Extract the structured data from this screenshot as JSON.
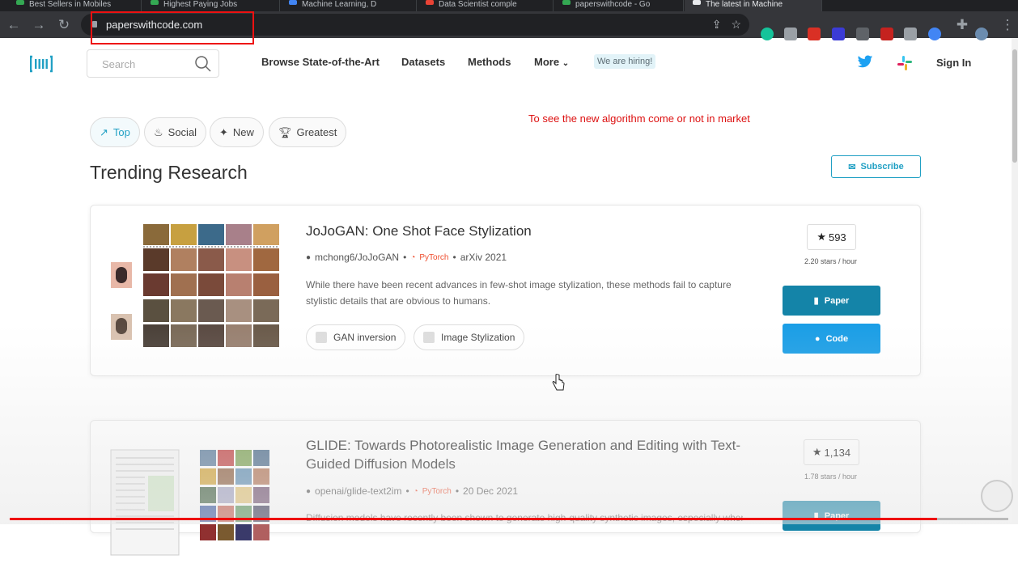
{
  "browser": {
    "tabs": [
      {
        "label": "Best Sellers in Mobiles",
        "color": "#34a853"
      },
      {
        "label": "Highest Paying Jobs",
        "color": "#34a853"
      },
      {
        "label": "Machine Learning, D",
        "color": "#4285f4"
      },
      {
        "label": "Data Scientist comple",
        "color": "#ea4335"
      },
      {
        "label": "paperswithcode - Go",
        "color": "#34a853"
      },
      {
        "label": "The latest in Machine",
        "color": "#e8eaed"
      }
    ],
    "url": "paperswithcode.com"
  },
  "header": {
    "search_placeholder": "Search",
    "nav": [
      "Browse State-of-the-Art",
      "Datasets",
      "Methods",
      "More"
    ],
    "hiring": "We are hiring!",
    "signin": "Sign In"
  },
  "annotation": "To see the new algorithm come or not in market",
  "filters": [
    "Top",
    "Social",
    "New",
    "Greatest"
  ],
  "section_title": "Trending Research",
  "subscribe": "Subscribe",
  "papers": [
    {
      "title": "JoJoGAN: One Shot Face Stylization",
      "repo": "mchong6/JoJoGAN",
      "framework": "PyTorch",
      "venue": "arXiv 2021",
      "abstract": "While there have been recent advances in few-shot image stylization, these methods fail to capture stylistic details that are obvious to humans.",
      "tags": [
        "GAN inversion",
        "Image Stylization"
      ],
      "stars": "593",
      "rate": "2.20 stars / hour",
      "paper_label": "Paper",
      "code_label": "Code"
    },
    {
      "title": "GLIDE: Towards Photorealistic Image Generation and Editing with Text-Guided Diffusion Models",
      "repo": "openai/glide-text2im",
      "framework": "PyTorch",
      "venue": "20 Dec 2021",
      "abstract": "Diffusion models have recently been shown to generate high-quality synthetic images, especially when",
      "stars": "1,134",
      "rate": "1.78 stars / hour",
      "paper_label": "Paper"
    }
  ],
  "colors": {
    "accent": "#21a0c4",
    "paper_btn": "#1484a8",
    "code_btn": "#1a9ee6",
    "annotation": "#dd1111"
  }
}
